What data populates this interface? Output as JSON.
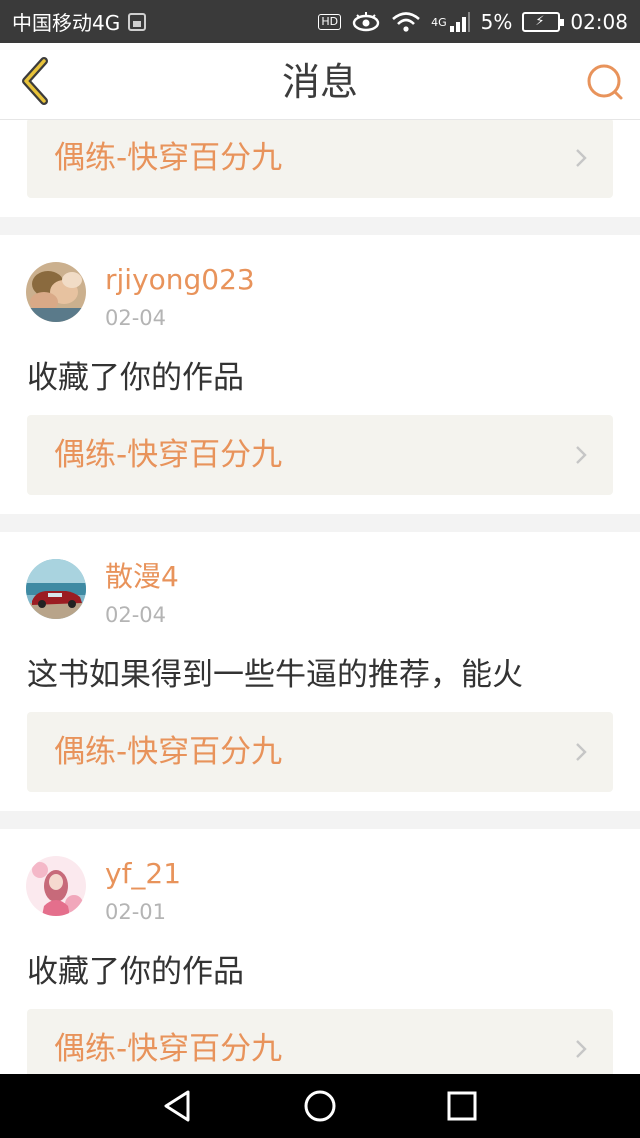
{
  "status_bar": {
    "carrier": "中国移动4G",
    "hd": "HD",
    "network": "4G",
    "battery_percent": "5%",
    "time": "02:08",
    "icons": [
      "image-notification-icon",
      "hd-icon",
      "eye-icon",
      "wifi-icon",
      "signal-icon",
      "battery-charging-icon"
    ]
  },
  "header": {
    "title": "消息",
    "back_icon": "back-chevron-icon",
    "search_icon": "search-icon",
    "accent_color": "#e8935b"
  },
  "messages": [
    {
      "work_title": "偶练-快穿百分九"
    },
    {
      "username": "rjiyong023",
      "date": "02-04",
      "text": "收藏了你的作品",
      "work_title": "偶练-快穿百分九"
    },
    {
      "username": "散漫4",
      "date": "02-04",
      "text": "这书如果得到一些牛逼的推荐，能火",
      "work_title": "偶练-快穿百分九"
    },
    {
      "username": "yf_21",
      "date": "02-01",
      "text": "收藏了你的作品",
      "work_title": "偶练-快穿百分九"
    }
  ],
  "nav_bar": {
    "icons": [
      "nav-back-icon",
      "nav-home-icon",
      "nav-recent-icon"
    ]
  }
}
